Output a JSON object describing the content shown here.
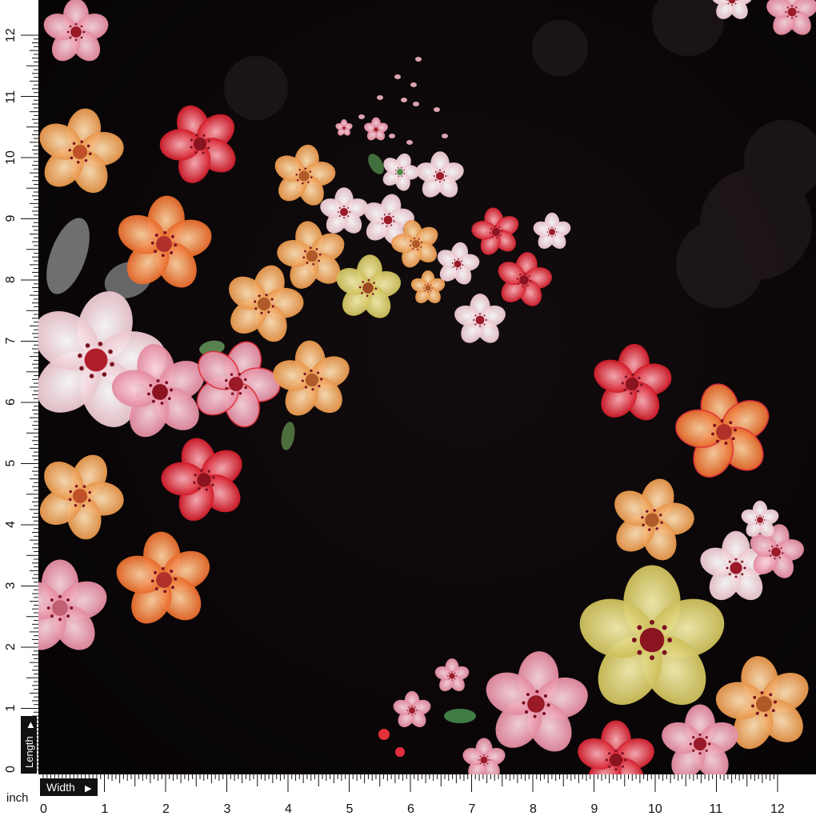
{
  "product": {
    "description_visible": false
  },
  "ruler": {
    "unit_label": "inch",
    "width_label": "Width",
    "length_label": "Length",
    "bottom_numbers": [
      "0",
      "1",
      "2",
      "3",
      "4",
      "5",
      "6",
      "7",
      "8",
      "9",
      "10",
      "11",
      "12"
    ],
    "left_numbers": [
      "0",
      "1",
      "2",
      "3",
      "4",
      "5",
      "6",
      "7",
      "8",
      "9",
      "10",
      "11",
      "12"
    ],
    "arrow_glyph": "▶"
  },
  "colors": {
    "background_fabric": "#0b0709",
    "ruler_bg": "#ffffff",
    "ruler_ink": "#111111",
    "label_bg": "#111111",
    "label_fg": "#ffffff",
    "petal_pink": "#f2a7b6",
    "petal_red": "#e0303c",
    "petal_orange": "#f08a3a",
    "petal_peach": "#f3b06a",
    "petal_yellow": "#dfd27a",
    "petal_pale": "#f4e2e6",
    "center_dark": "#8a1420",
    "leaf_green": "#5c8a4a"
  }
}
